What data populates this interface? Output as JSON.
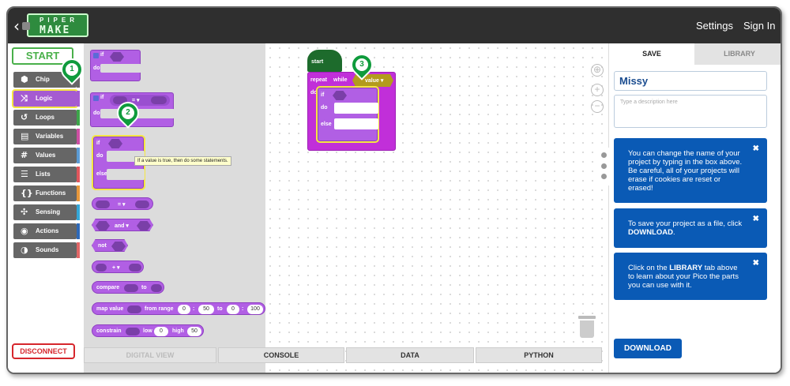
{
  "header": {
    "back_icon": "chevron-left-icon",
    "logo_top": "PIPER",
    "logo_bottom": "MAKE",
    "settings": "Settings",
    "sign_in": "Sign In"
  },
  "sidebar": {
    "start": "START",
    "disconnect": "DISCONNECT",
    "items": [
      {
        "label": "Chip",
        "icon": "chip-icon",
        "glyph": "⬢",
        "color": "#666666"
      },
      {
        "label": "Logic",
        "icon": "shuffle-icon",
        "glyph": "⤨",
        "color": "#a55bd1"
      },
      {
        "label": "Loops",
        "icon": "loop-icon",
        "glyph": "↺",
        "color": "#3da54a"
      },
      {
        "label": "Variables",
        "icon": "variables-icon",
        "glyph": "▤",
        "color": "#cc4fa3"
      },
      {
        "label": "Values",
        "icon": "hash-icon",
        "glyph": "#",
        "color": "#5b9bd5"
      },
      {
        "label": "Lists",
        "icon": "list-icon",
        "glyph": "☰",
        "color": "#e0565c"
      },
      {
        "label": "Functions",
        "icon": "braces-icon",
        "glyph": "{}",
        "color": "#e8973a"
      },
      {
        "label": "Sensing",
        "icon": "sensing-icon",
        "glyph": "✣",
        "color": "#34a7d8"
      },
      {
        "label": "Actions",
        "icon": "actions-icon",
        "glyph": "◉",
        "color": "#2e69b8"
      },
      {
        "label": "Sounds",
        "icon": "sound-icon",
        "glyph": "◑",
        "color": "#e06666"
      }
    ]
  },
  "flyout": {
    "if": "if",
    "do": "do",
    "else": "else",
    "eq": "= ▾",
    "and": "and ▾",
    "not": "not",
    "plus": "+ ▾",
    "compare": "compare",
    "to": "to",
    "map_value": "map value",
    "from_range": "from range",
    "range_sep": ":",
    "map_nums": [
      "0",
      "50",
      "0",
      "100"
    ],
    "constrain": "constrain",
    "low": "low",
    "high": "high",
    "low_val": "0",
    "high_val": "50",
    "tooltip": "If a value is true, then do some statements."
  },
  "markers": [
    "1",
    "2",
    "3"
  ],
  "script": {
    "start": "start",
    "repeat": "repeat",
    "while": "while",
    "value": "value ▾",
    "do": "do",
    "if": "if",
    "else": "else"
  },
  "workspace_controls": [
    "center-icon",
    "zoom-in-icon",
    "zoom-out-icon",
    "trash-icon"
  ],
  "bottom_tabs": [
    "DIGITAL VIEW",
    "CONSOLE",
    "DATA",
    "PYTHON"
  ],
  "right_panel": {
    "tabs": [
      "SAVE",
      "LIBRARY"
    ],
    "project_name": "Missy",
    "description_placeholder": "Type a description here",
    "card1": "You can change the name of your project by typing in the box above. Be careful, all of your projects will erase if cookies are reset or erased!",
    "card2_pre": "To save your project as a file, click ",
    "card2_bold": "DOWNLOAD",
    "card2_post": ".",
    "card3_pre": "Click on the ",
    "card3_bold": "LIBRARY",
    "card3_post": " tab above to learn about your Pico the parts you can use with it.",
    "close": "✖",
    "download": "DOWNLOAD"
  }
}
